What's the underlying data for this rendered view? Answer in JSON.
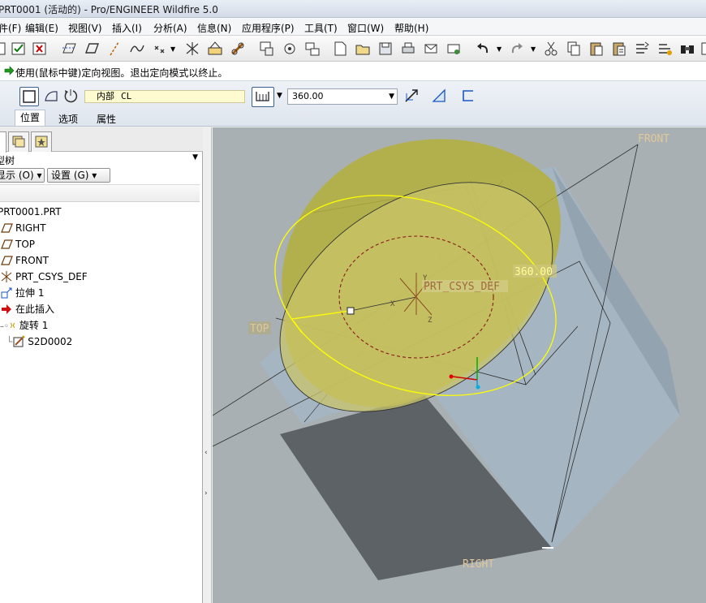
{
  "title": "PRT0001 (活动的) - Pro/ENGINEER Wildfire 5.0",
  "menu": [
    "文件(F)",
    "编辑(E)",
    "视图(V)",
    "插入(I)",
    "分析(A)",
    "信息(N)",
    "应用程序(P)",
    "工具(T)",
    "窗口(W)",
    "帮助(H)"
  ],
  "menu_visible": [
    "件(F)",
    "编辑(E)",
    "视图(V)",
    "插入(I)",
    "分析(A)",
    "信息(N)",
    "应用程序(P)",
    "工具(T)",
    "窗口(W)",
    "帮助(H)"
  ],
  "message": "使用(鼠标中键)定向视图。退出定向模式以终止。",
  "dashboard": {
    "ref_label": "内部",
    "ref_value": "CL",
    "angle_value": "360.00",
    "tabs": [
      "位置",
      "选项",
      "属性"
    ]
  },
  "panel": {
    "tree_title": "型树",
    "show_button": "显示 (O) ▾",
    "settings_button": "设置 (G) ▾",
    "tree": [
      {
        "label": "PRT0001.PRT",
        "icon": "part-icon"
      },
      {
        "label": "RIGHT",
        "icon": "datum-plane-icon"
      },
      {
        "label": "TOP",
        "icon": "datum-plane-icon"
      },
      {
        "label": "FRONT",
        "icon": "datum-plane-icon"
      },
      {
        "label": "PRT_CSYS_DEF",
        "icon": "csys-icon"
      },
      {
        "label": "拉伸 1",
        "icon": "extrude-icon"
      },
      {
        "label": "在此插入",
        "icon": "insert-arrow-icon"
      },
      {
        "label": "旋转 1",
        "icon": "revolve-icon"
      },
      {
        "label": "S2D0002",
        "icon": "sketch-icon"
      }
    ]
  },
  "viewport": {
    "labels": {
      "front": "FRONT",
      "top": "TOP",
      "right": "RIGHT",
      "csys": "PRT_CSYS_DEF",
      "angle": "360.00",
      "axis_x": "X",
      "axis_y": "Y",
      "axis_z": "Z"
    },
    "colors": {
      "background": "#a9b0b3",
      "block_face": "#a6b6c3",
      "block_dark_face": "#5c6166",
      "dome": "#b9b33a",
      "sketch": "#ffff00",
      "dashed_circle": "#8b1a1a"
    }
  }
}
